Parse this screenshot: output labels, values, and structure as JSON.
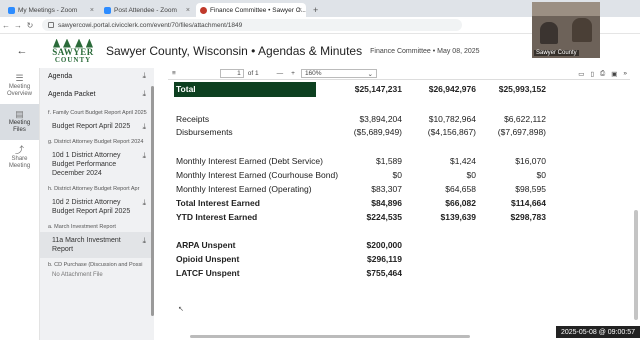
{
  "browser": {
    "tabs": [
      {
        "title": "My Meetings - Zoom",
        "color": "#2d8cff"
      },
      {
        "title": "Post Attendee - Zoom",
        "color": "#2d8cff"
      },
      {
        "title": "Finance Committee • Sawyer C...",
        "color": "#c0392b"
      }
    ],
    "new_tab": "+",
    "close": "×",
    "url": "sawyercowi.portal.civicclerk.com/event/70/files/attachment/1849"
  },
  "header": {
    "back": "←",
    "logo_line1": "SAWYER",
    "logo_line2": "COUNTY",
    "title": "Sawyer County, Wisconsin • Agendas & Minutes",
    "subtitle": "Finance Committee • May 08, 2025"
  },
  "video": {
    "label": "Sawyer County"
  },
  "rail": [
    {
      "icon": "☰",
      "label": "Meeting Overview"
    },
    {
      "icon": "▤",
      "label": "Meeting Files"
    },
    {
      "icon": "⤴",
      "label": "Share Meeting"
    }
  ],
  "panel": {
    "agenda": "Agenda",
    "agenda_packet": "Agenda Packet",
    "sections": [
      {
        "heading": "f. Family Court Budget Report April 2025",
        "file": "Budget Report April 2025"
      },
      {
        "heading": "g. District Attorney Budget Report 2024",
        "file": "10d 1 District Attorney Budget Performance December 2024"
      },
      {
        "heading": "h. District Attorney Budget Report Apr",
        "file": "10d 2 District Attorney Budget Report April 2025"
      },
      {
        "heading": "a. March Investment Report",
        "file": "11a March Investment Report"
      },
      {
        "heading": "b. CD Purchase (Discussion and Possi",
        "file": "No Attachment File"
      }
    ]
  },
  "toolbar": {
    "minus": "—",
    "page": "1",
    "of": "of 1",
    "zoom_minus": "—",
    "zoom_plus": "+",
    "zoom": "160%"
  },
  "report": {
    "total_label": "Total",
    "total": [
      "$25,147,231",
      "$26,942,976",
      "$25,993,152"
    ],
    "receipts_label": "Receipts",
    "receipts": [
      "$3,894,204",
      "$10,782,964",
      "$6,622,112"
    ],
    "disb_label": "Disbursements",
    "disb": [
      "($5,689,949)",
      "($4,156,867)",
      "($7,697,898)"
    ],
    "int_debt_label": "Monthly Interest Earned (Debt Service)",
    "int_debt": [
      "$1,589",
      "$1,424",
      "$16,070"
    ],
    "int_court_label": "Monthly Interest Earned (Courhouse Bond)",
    "int_court": [
      "$0",
      "$0",
      "$0"
    ],
    "int_oper_label": "Monthly Interest Earned (Operating)",
    "int_oper": [
      "$83,307",
      "$64,658",
      "$98,595"
    ],
    "total_int_label": "Total Interest Earned",
    "total_int": [
      "$84,896",
      "$66,082",
      "$114,664"
    ],
    "ytd_label": "YTD Interest Earned",
    "ytd": [
      "$224,535",
      "$139,639",
      "$298,783"
    ],
    "arpa_label": "ARPA Unspent",
    "arpa": "$200,000",
    "opioid_label": "Opioid Unspent",
    "opioid": "$296,119",
    "latcf_label": "LATCF Unspent",
    "latcf": "$755,464"
  },
  "timestamp": "2025-05-08 @ 09:00:57"
}
